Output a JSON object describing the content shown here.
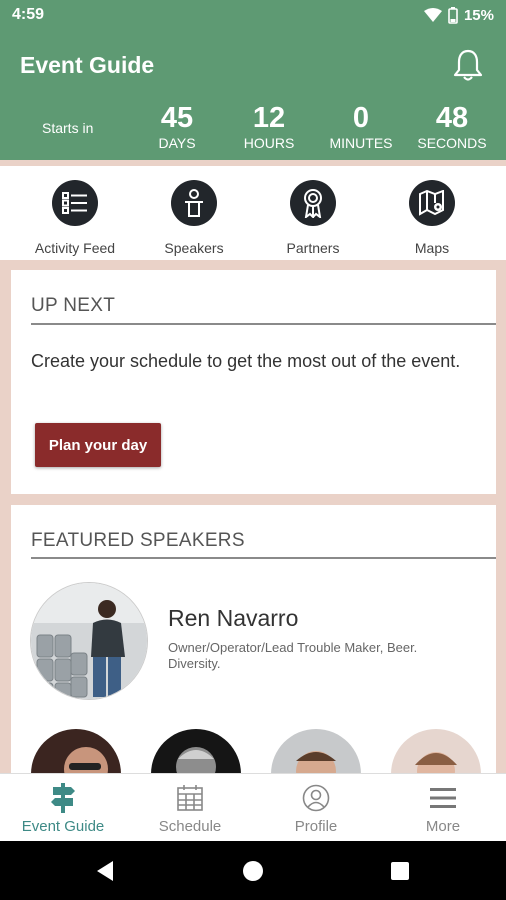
{
  "status_bar": {
    "time": "4:59",
    "battery": "15%"
  },
  "header": {
    "title": "Event Guide",
    "countdown": {
      "label": "Starts in",
      "days": {
        "value": "45",
        "label": "DAYS"
      },
      "hours": {
        "value": "12",
        "label": "HOURS"
      },
      "minutes": {
        "value": "0",
        "label": "MINUTES"
      },
      "seconds": {
        "value": "48",
        "label": "SECONDS"
      }
    }
  },
  "quick_nav": [
    {
      "label": "Activity Feed",
      "icon": "list-icon"
    },
    {
      "label": "Speakers",
      "icon": "speaker-podium-icon"
    },
    {
      "label": "Partners",
      "icon": "ribbon-icon"
    },
    {
      "label": "Maps",
      "icon": "map-icon"
    }
  ],
  "up_next": {
    "title": "UP NEXT",
    "text": "Create your schedule to get the most out of the event.",
    "button": "Plan your day"
  },
  "featured_speakers": {
    "title": "FEATURED SPEAKERS",
    "featured": {
      "name": "Ren Navarro",
      "title": "Owner/Operator/Lead Trouble Maker, Beer. Diversity."
    }
  },
  "bottom_nav": [
    {
      "label": "Event Guide",
      "icon": "signpost-icon",
      "active": true
    },
    {
      "label": "Schedule",
      "icon": "calendar-icon",
      "active": false
    },
    {
      "label": "Profile",
      "icon": "profile-icon",
      "active": false
    },
    {
      "label": "More",
      "icon": "menu-icon",
      "active": false
    }
  ],
  "colors": {
    "header_bg": "#5e9a73",
    "page_bg": "#ead2c8",
    "accent_button": "#8a2b2b",
    "active_tab": "#3e8a86"
  }
}
